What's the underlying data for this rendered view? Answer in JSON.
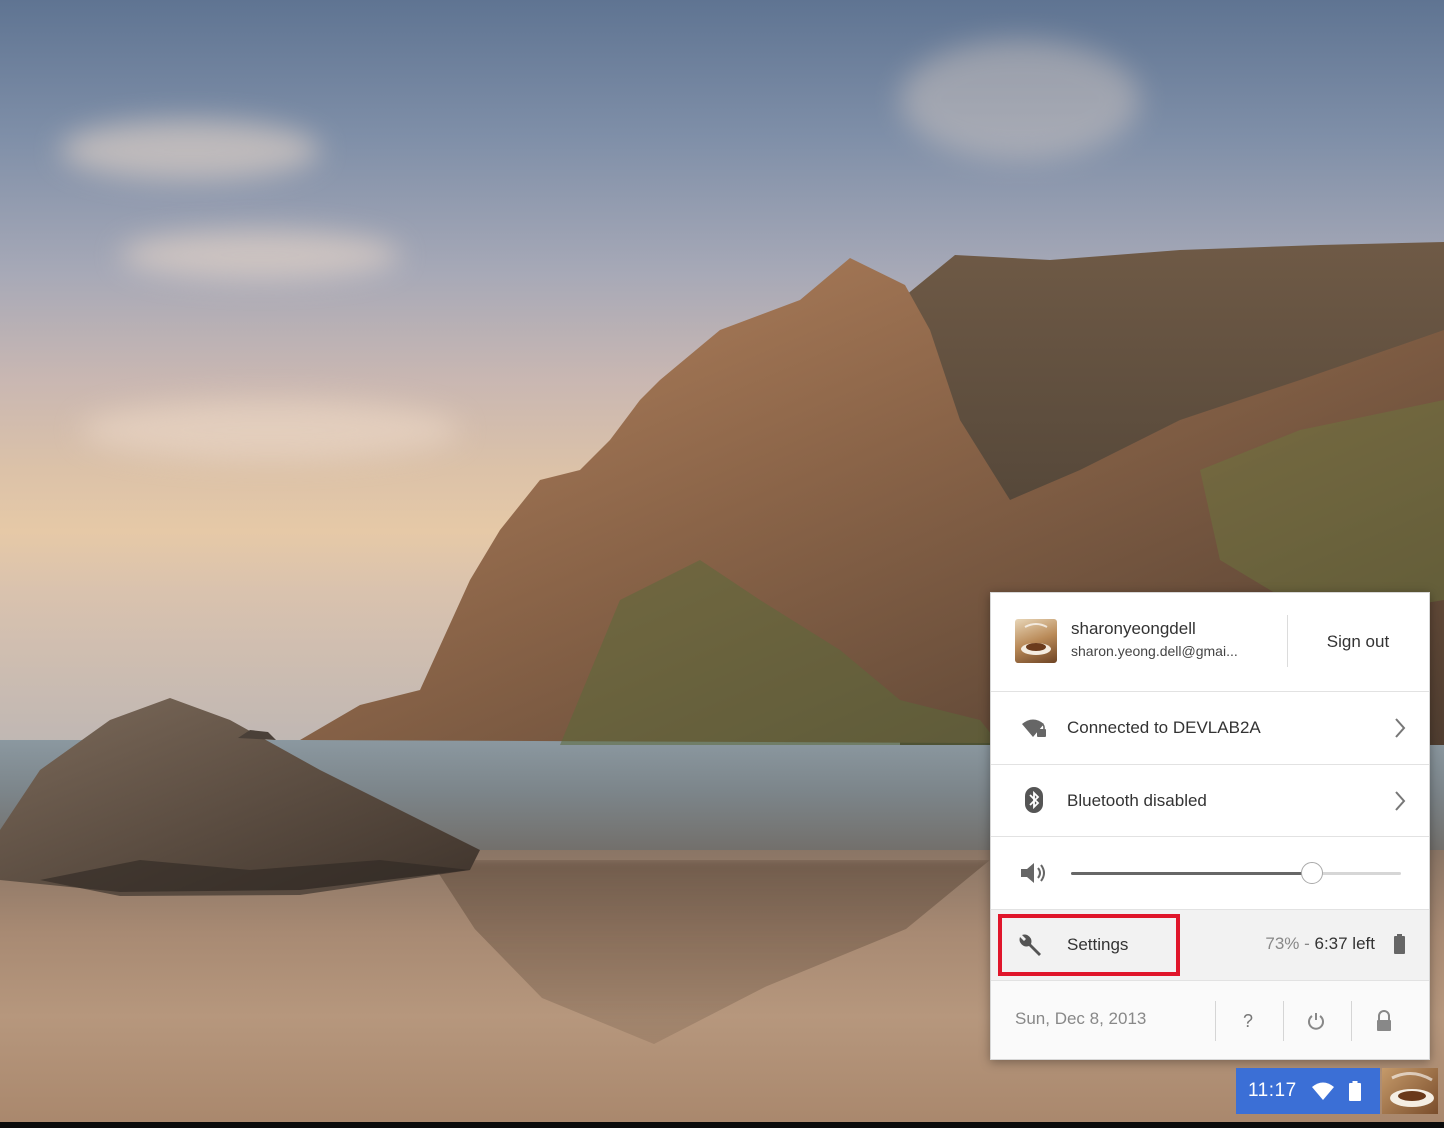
{
  "user": {
    "name": "sharonyeongdell",
    "email": "sharon.yeong.dell@gmai...",
    "sign_out_label": "Sign out"
  },
  "network": {
    "label": "Connected to DEVLAB2A",
    "icon": "wifi-lock-icon"
  },
  "bluetooth": {
    "label": "Bluetooth disabled",
    "icon": "bluetooth-icon"
  },
  "volume": {
    "icon": "speaker-icon",
    "level": 0.73
  },
  "settings": {
    "label": "Settings",
    "icon": "wrench-icon"
  },
  "battery": {
    "percent": "73%",
    "separator": " - ",
    "time_left": "6:37 left",
    "icon": "battery-icon"
  },
  "date": {
    "text": "Sun, Dec 8, 2013"
  },
  "footer_buttons": {
    "help_label": "?",
    "power_icon": "power-icon",
    "lock_icon": "lock-icon"
  },
  "shelf": {
    "time": "11:17",
    "accent": "#3b6fd6"
  },
  "highlight_color": "#e0162b"
}
